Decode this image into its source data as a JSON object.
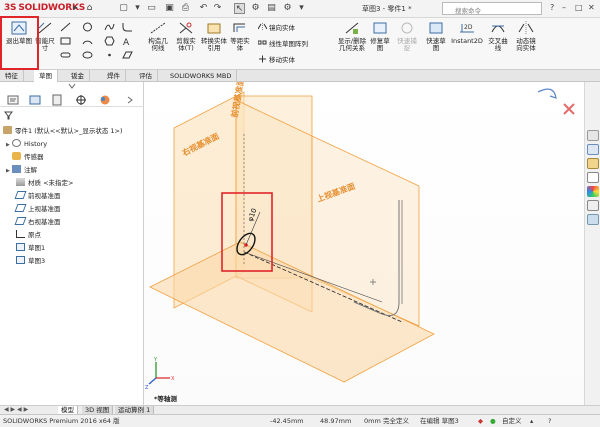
{
  "app": {
    "logo_text": "SOLIDWORKS",
    "document_title": "草图3 - 零件1 *",
    "search_placeholder": "搜索命令"
  },
  "ribbon": {
    "exit_sketch_label": "退出草图",
    "smart_dimension_label": "智能尺寸",
    "construction_geometry_label": "构造几何线",
    "trim_entities_label": "剪裁实体(T)",
    "convert_entities_label": "转换实体引用",
    "offset_entities_label": "等距实体",
    "mirror_entities_label": "镜向实体",
    "linear_pattern_label": "线性草图阵列",
    "move_entities_label": "移动实体",
    "display_relations_label": "显示/删除几何关系",
    "repair_sketch_label": "修复草图",
    "quick_snaps_label": "快速捕捉",
    "rapid_sketch_label": "快速草图",
    "instant2d_label": "Instant2D",
    "intersection_curve_label": "交叉曲线",
    "dynamic_mirror_label": "动态镜向实体"
  },
  "tabs": [
    "特征",
    "草图",
    "钣金",
    "焊件",
    "评估",
    "SOLIDWORKS MBD"
  ],
  "active_tab_index": 1,
  "tree": {
    "root": "零件1 (默认<<默认>_显示状态 1>)",
    "items": [
      "History",
      "传感器",
      "注解",
      "材质 <未指定>",
      "前视基准面",
      "上视基准面",
      "右视基准面",
      "原点",
      "草图1",
      "草图3"
    ]
  },
  "viewport": {
    "plane_right": "右视基准面",
    "plane_front": "前视基准面",
    "plane_top": "上视基准面",
    "dimension": "φ10",
    "view_name": "*等轴测"
  },
  "bottom_tabs": [
    "模型",
    "3D 视图",
    "运动算例 1"
  ],
  "active_bottom_tab_index": 0,
  "status": {
    "product": "SOLIDWORKS Premium 2016 x64 版",
    "x": "-42.45mm",
    "y": "48.97mm",
    "z": "0mm",
    "definition": "完全定义",
    "editing": "在编辑 草图3",
    "units": "自定义"
  },
  "colors": {
    "plane_fill": "#fbd9a8",
    "plane_stroke": "#f0a040",
    "highlight": "#e0252a",
    "tab_active": "#ffffff"
  }
}
